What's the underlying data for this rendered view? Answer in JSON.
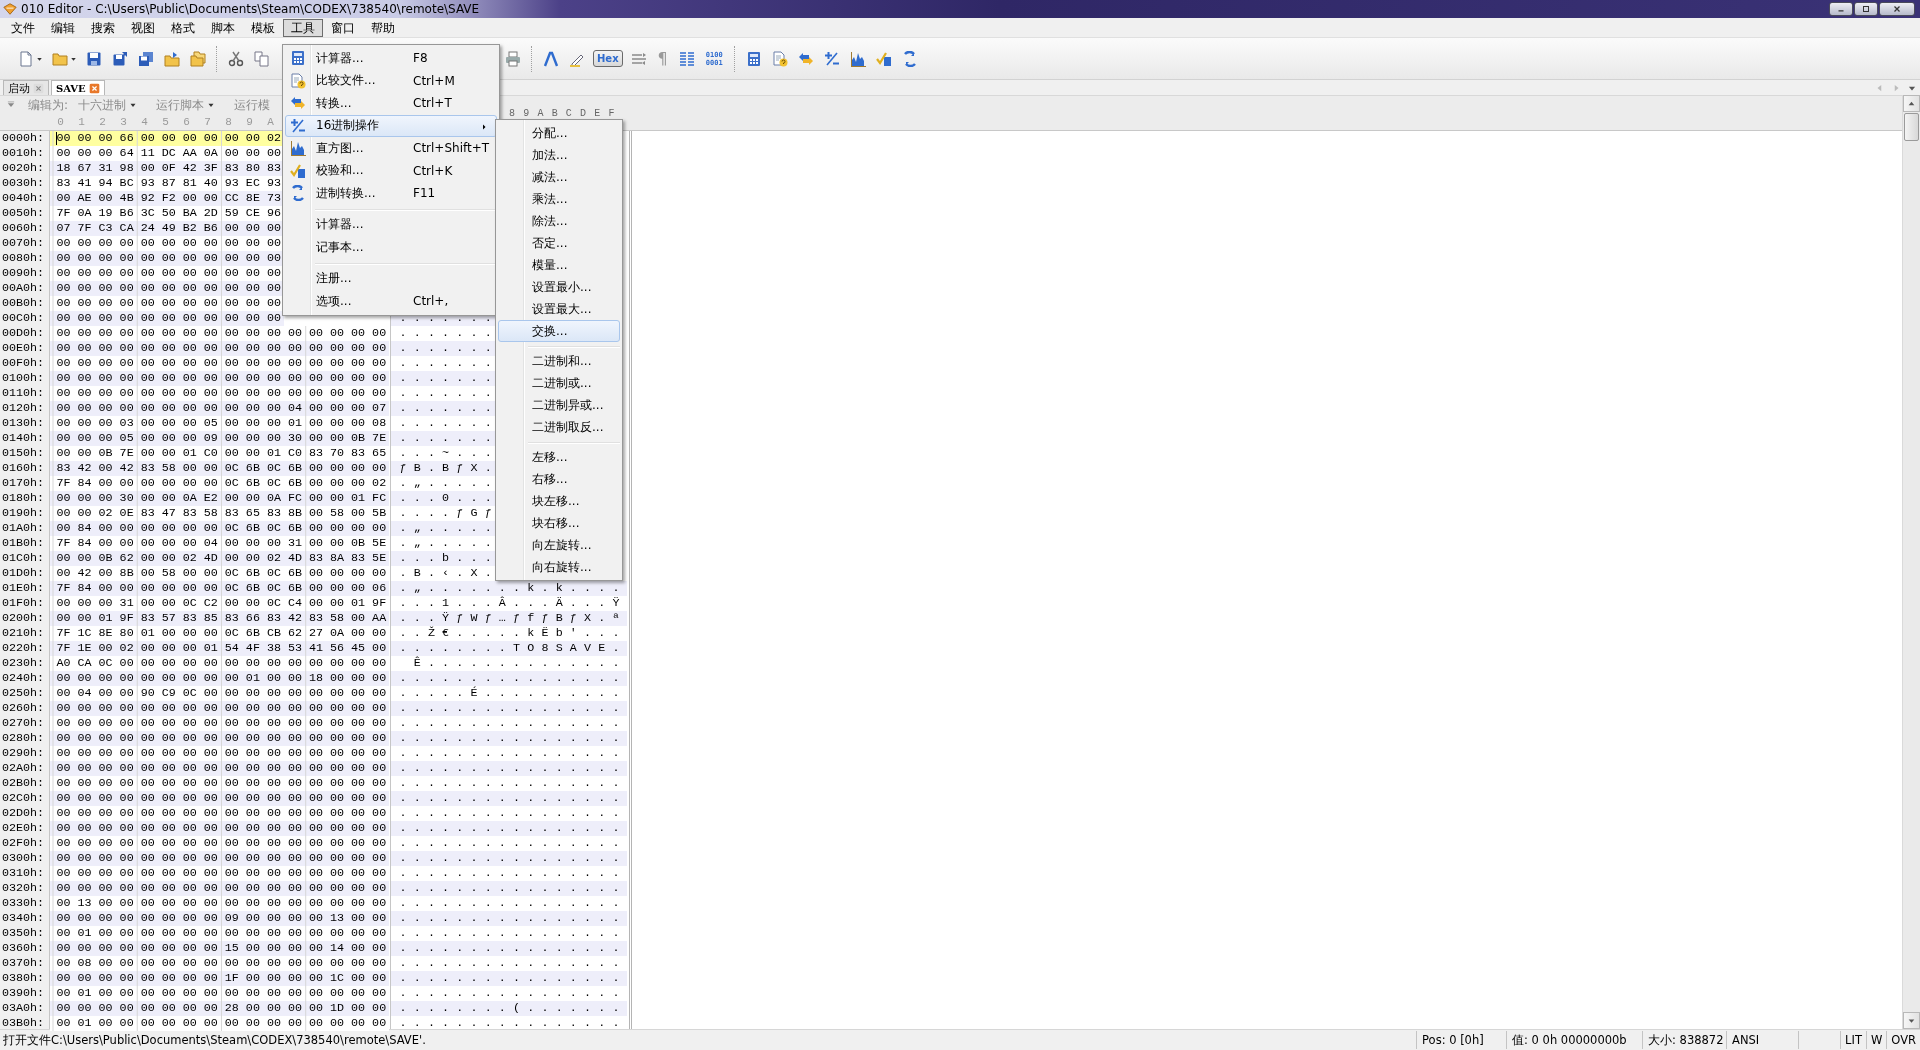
{
  "window": {
    "title": "010 Editor - C:\\Users\\Public\\Documents\\Steam\\CODEX\\738540\\remote\\SAVE"
  },
  "menubar": [
    {
      "label": "文件",
      "selected": false
    },
    {
      "label": "编辑",
      "selected": false
    },
    {
      "label": "搜索",
      "selected": false
    },
    {
      "label": "视图",
      "selected": false
    },
    {
      "label": "格式",
      "selected": false
    },
    {
      "label": "脚本",
      "selected": false
    },
    {
      "label": "模板",
      "selected": false
    },
    {
      "label": "工具",
      "selected": true
    },
    {
      "label": "窗口",
      "selected": false
    },
    {
      "label": "帮助",
      "selected": false
    }
  ],
  "toolbar": {
    "hex_button": {
      "label": "Hex",
      "on": true
    },
    "paragraph_mark": "¶",
    "bits_label": [
      "0100",
      "0001"
    ]
  },
  "tabs": [
    {
      "label": "启动",
      "selected": false
    },
    {
      "label": "SAVE",
      "selected": true
    }
  ],
  "editor_bar": {
    "edit_as_label": "编辑为:",
    "edit_as_value": "十六进制",
    "run_script": "运行脚本",
    "run_template": "运行模"
  },
  "columns": {
    "hex": [
      "0",
      "1",
      "2",
      "3",
      "4",
      "5",
      "6",
      "7",
      "8",
      "9",
      "A"
    ],
    "text": [
      "8",
      "9",
      "A",
      "B",
      "C",
      "D",
      "E",
      "F"
    ]
  },
  "rows": [
    {
      "offset": "0000h:",
      "hex": "00 00 00 66 00 00 00 00 00 00 02",
      "selected": true
    },
    {
      "offset": "0010h:",
      "hex": "00 00 00 64 11 DC AA 0A 00 00 00",
      "selected": false
    },
    {
      "offset": "0020h:",
      "hex": "18 67 31 98 00 0F 42 3F 83 80 83",
      "selected": false
    },
    {
      "offset": "0030h:",
      "hex": "83 41 94 BC 93 87 81 40 93 EC 93",
      "selected": false
    },
    {
      "offset": "0040h:",
      "hex": "00 AE 00 4B 92 F2 00 00 CC 8E 73",
      "selected": false
    },
    {
      "offset": "0050h:",
      "hex": "7F 0A 19 B6 3C 50 BA 2D 59 CE 96",
      "selected": false
    },
    {
      "offset": "0060h:",
      "hex": "07 7F C3 CA 24 49 B2 B6 00 00 00",
      "selected": false
    },
    {
      "offset": "0070h:",
      "hex": "00 00 00 00 00 00 00 00 00 00 00",
      "selected": false
    },
    {
      "offset": "0080h:",
      "hex": "00 00 00 00 00 00 00 00 00 00 00",
      "selected": false
    },
    {
      "offset": "0090h:",
      "hex": "00 00 00 00 00 00 00 00 00 00 00",
      "selected": false
    },
    {
      "offset": "00A0h:",
      "hex": "00 00 00 00 00 00 00 00 00 00 00",
      "selected": false
    },
    {
      "offset": "00B0h:",
      "hex": "00 00 00 00 00 00 00 00 00 00 00",
      "selected": false
    },
    {
      "offset": "00C0h:",
      "hex": "00 00 00 00 00 00 00 00 00 00 00",
      "text": ".......",
      "selected": false
    },
    {
      "offset": "00D0h:",
      "hex": "00 00 00 00 00 00 00 00 00 00 00 00 00 00 00 00",
      "text": ".......",
      "selected": false
    },
    {
      "offset": "00E0h:",
      "hex": "00 00 00 00 00 00 00 00 00 00 00 00 00 00 00 00",
      "text": ".......",
      "selected": false
    },
    {
      "offset": "00F0h:",
      "hex": "00 00 00 00 00 00 00 00 00 00 00 00 00 00 00 00",
      "text": ".......",
      "selected": false
    },
    {
      "offset": "0100h:",
      "hex": "00 00 00 00 00 00 00 00 00 00 00 00 00 00 00 00",
      "text": ".......",
      "selected": false
    },
    {
      "offset": "0110h:",
      "hex": "00 00 00 00 00 00 00 00 00 00 00 00 00 00 00 00",
      "text": ".......",
      "selected": false
    },
    {
      "offset": "0120h:",
      "hex": "00 00 00 00 00 00 00 00 00 00 00 04 00 00 00 07",
      "text": ".......",
      "selected": false
    },
    {
      "offset": "0130h:",
      "hex": "00 00 00 03 00 00 00 05 00 00 00 01 00 00 00 08",
      "text": ".......",
      "selected": false
    },
    {
      "offset": "0140h:",
      "hex": "00 00 00 05 00 00 00 09 00 00 00 30 00 00 0B 7E",
      "text": ".......",
      "selected": false
    },
    {
      "offset": "0150h:",
      "hex": "00 00 0B 7E 00 00 01 C0 00 00 01 C0 83 70 83 65",
      "text": "...~...",
      "selected": false
    },
    {
      "offset": "0160h:",
      "hex": "83 42 00 42 83 58 00 00 0C 6B 0C 6B 00 00 00 00",
      "text": "ƒB.BƒX.",
      "selected": false
    },
    {
      "offset": "0170h:",
      "hex": "7F 84 00 00 00 00 00 00 0C 6B 0C 6B 00 00 00 02",
      "text": ".„.....",
      "selected": false
    },
    {
      "offset": "0180h:",
      "hex": "00 00 00 30 00 00 0A E2 00 00 0A FC 00 00 01 FC",
      "text": "...0...",
      "selected": false
    },
    {
      "offset": "0190h:",
      "hex": "00 00 02 0E 83 47 83 58 83 65 83 8B 00 58 00 5B",
      "text": "....ƒGƒ",
      "selected": false
    },
    {
      "offset": "01A0h:",
      "hex": "00 84 00 00 00 00 00 00 0C 6B 0C 6B 00 00 00 00",
      "text": ".„.....",
      "selected": false
    },
    {
      "offset": "01B0h:",
      "hex": "7F 84 00 00 00 00 00 04 00 00 00 31 00 00 0B 5E",
      "text": ".„.....",
      "selected": false
    },
    {
      "offset": "01C0h:",
      "hex": "00 00 0B 62 00 00 02 4D 00 00 02 4D 83 8A 83 5E",
      "text": "...b...",
      "selected": false
    },
    {
      "offset": "01D0h:",
      "hex": "00 42 00 8B 00 58 00 00 0C 6B 0C 6B 00 00 00 00",
      "text": ".B.‹.X.",
      "selected": false
    },
    {
      "offset": "01E0h:",
      "hex": "7F 84 00 00 00 00 00 00 0C 6B 0C 6B 00 00 00 06",
      "text": ".„.......k.k....",
      "selected": false
    },
    {
      "offset": "01F0h:",
      "hex": "00 00 00 31 00 00 0C C2 00 00 0C C4 00 00 01 9F",
      "text": "...1...Â...Ä...Ÿ",
      "selected": false
    },
    {
      "offset": "0200h:",
      "hex": "00 00 01 9F 83 57 83 85 83 66 83 42 83 58 00 AA",
      "text": "...ŸƒWƒ…ƒfƒBƒX.ª",
      "selected": false
    },
    {
      "offset": "0210h:",
      "hex": "7F 1C 8E 80 01 00 00 00 0C 6B CB 62 27 0A 00 00",
      "text": "..Ž€.....kËb'...",
      "selected": false
    },
    {
      "offset": "0220h:",
      "hex": "7F 1E 00 02 00 00 00 01 54 4F 38 53 41 56 45 00",
      "text": "........TO8SAVE.",
      "selected": false
    },
    {
      "offset": "0230h:",
      "hex": "A0 CA 0C 00 00 00 00 00 00 00 00 00 00 00 00 00",
      "text": " Ê..............",
      "selected": false
    },
    {
      "offset": "0240h:",
      "hex": "00 00 00 00 00 00 00 00 00 01 00 00 18 00 00 00",
      "text": "................",
      "selected": false
    },
    {
      "offset": "0250h:",
      "hex": "00 04 00 00 90 C9 0C 00 00 00 00 00 00 00 00 00",
      "text": ".....É..........",
      "selected": false
    },
    {
      "offset": "0260h:",
      "hex": "00 00 00 00 00 00 00 00 00 00 00 00 00 00 00 00",
      "text": "................",
      "selected": false
    },
    {
      "offset": "0270h:",
      "hex": "00 00 00 00 00 00 00 00 00 00 00 00 00 00 00 00",
      "text": "................",
      "selected": false
    },
    {
      "offset": "0280h:",
      "hex": "00 00 00 00 00 00 00 00 00 00 00 00 00 00 00 00",
      "text": "................",
      "selected": false
    },
    {
      "offset": "0290h:",
      "hex": "00 00 00 00 00 00 00 00 00 00 00 00 00 00 00 00",
      "text": "................",
      "selected": false
    },
    {
      "offset": "02A0h:",
      "hex": "00 00 00 00 00 00 00 00 00 00 00 00 00 00 00 00",
      "text": "................",
      "selected": false
    },
    {
      "offset": "02B0h:",
      "hex": "00 00 00 00 00 00 00 00 00 00 00 00 00 00 00 00",
      "text": "................",
      "selected": false
    },
    {
      "offset": "02C0h:",
      "hex": "00 00 00 00 00 00 00 00 00 00 00 00 00 00 00 00",
      "text": "................",
      "selected": false
    },
    {
      "offset": "02D0h:",
      "hex": "00 00 00 00 00 00 00 00 00 00 00 00 00 00 00 00",
      "text": "................",
      "selected": false
    },
    {
      "offset": "02E0h:",
      "hex": "00 00 00 00 00 00 00 00 00 00 00 00 00 00 00 00",
      "text": "................",
      "selected": false
    },
    {
      "offset": "02F0h:",
      "hex": "00 00 00 00 00 00 00 00 00 00 00 00 00 00 00 00",
      "text": "................",
      "selected": false
    },
    {
      "offset": "0300h:",
      "hex": "00 00 00 00 00 00 00 00 00 00 00 00 00 00 00 00",
      "text": "................",
      "selected": false
    },
    {
      "offset": "0310h:",
      "hex": "00 00 00 00 00 00 00 00 00 00 00 00 00 00 00 00",
      "text": "................",
      "selected": false
    },
    {
      "offset": "0320h:",
      "hex": "00 00 00 00 00 00 00 00 00 00 00 00 00 00 00 00",
      "text": "................",
      "selected": false
    },
    {
      "offset": "0330h:",
      "hex": "00 13 00 00 00 00 00 00 00 00 00 00 00 00 00 00",
      "text": "................",
      "selected": false
    },
    {
      "offset": "0340h:",
      "hex": "00 00 00 00 00 00 00 00 09 00 00 00 00 13 00 00",
      "text": "................",
      "selected": false
    },
    {
      "offset": "0350h:",
      "hex": "00 01 00 00 00 00 00 00 00 00 00 00 00 00 00 00",
      "text": "................",
      "selected": false
    },
    {
      "offset": "0360h:",
      "hex": "00 00 00 00 00 00 00 00 15 00 00 00 00 14 00 00",
      "text": "................",
      "selected": false
    },
    {
      "offset": "0370h:",
      "hex": "00 08 00 00 00 00 00 00 00 00 00 00 00 00 00 00",
      "text": "................",
      "selected": false
    },
    {
      "offset": "0380h:",
      "hex": "00 00 00 00 00 00 00 00 1F 00 00 00 00 1C 00 00",
      "text": "................",
      "selected": false
    },
    {
      "offset": "0390h:",
      "hex": "00 01 00 00 00 00 00 00 00 00 00 00 00 00 00 00",
      "text": "................",
      "selected": false
    },
    {
      "offset": "03A0h:",
      "hex": "00 00 00 00 00 00 00 00 28 00 00 00 00 1D 00 00",
      "text": "........(.......",
      "selected": false
    },
    {
      "offset": "03B0h:",
      "hex": "00 01 00 00 00 00 00 00 00 00 00 00 00 00 00 00",
      "text": "................",
      "selected": false
    }
  ],
  "tools_menu": [
    {
      "kind": "item",
      "label": "计算器...",
      "shortcut": "F8",
      "submenu": false,
      "selected": false
    },
    {
      "kind": "item",
      "label": "比较文件...",
      "shortcut": "Ctrl+M",
      "submenu": false,
      "selected": false
    },
    {
      "kind": "item",
      "label": "转换...",
      "shortcut": "Ctrl+T",
      "submenu": false,
      "selected": false
    },
    {
      "kind": "item",
      "label": "16进制操作",
      "submenu": true,
      "selected": true
    },
    {
      "kind": "item",
      "label": "直方图...",
      "shortcut": "Ctrl+Shift+T",
      "submenu": false,
      "selected": false
    },
    {
      "kind": "item",
      "label": "校验和...",
      "shortcut": "Ctrl+K",
      "submenu": false,
      "selected": false
    },
    {
      "kind": "item",
      "label": "进制转换...",
      "shortcut": "F11",
      "submenu": false,
      "selected": false
    },
    {
      "kind": "separator"
    },
    {
      "kind": "item",
      "label": "计算器...",
      "submenu": false,
      "selected": false
    },
    {
      "kind": "item",
      "label": "记事本...",
      "submenu": false,
      "selected": false
    },
    {
      "kind": "separator"
    },
    {
      "kind": "item",
      "label": "注册...",
      "submenu": false,
      "selected": false
    },
    {
      "kind": "item",
      "label": "选项...",
      "shortcut": "Ctrl+,",
      "submenu": false,
      "selected": false
    }
  ],
  "hex_ops_menu": [
    {
      "kind": "item",
      "label": "分配...",
      "selected": false
    },
    {
      "kind": "item",
      "label": "加法...",
      "selected": false
    },
    {
      "kind": "item",
      "label": "减法...",
      "selected": false
    },
    {
      "kind": "item",
      "label": "乘法...",
      "selected": false
    },
    {
      "kind": "item",
      "label": "除法...",
      "selected": false
    },
    {
      "kind": "item",
      "label": "否定...",
      "selected": false
    },
    {
      "kind": "item",
      "label": "模量...",
      "selected": false
    },
    {
      "kind": "item",
      "label": "设置最小...",
      "selected": false
    },
    {
      "kind": "item",
      "label": "设置最大...",
      "selected": false
    },
    {
      "kind": "item",
      "label": "交换...",
      "selected": true
    },
    {
      "kind": "separator"
    },
    {
      "kind": "item",
      "label": "二进制和...",
      "selected": false
    },
    {
      "kind": "item",
      "label": "二进制或...",
      "selected": false
    },
    {
      "kind": "item",
      "label": "二进制异或...",
      "selected": false
    },
    {
      "kind": "item",
      "label": "二进制取反...",
      "selected": false
    },
    {
      "kind": "separator"
    },
    {
      "kind": "item",
      "label": "左移...",
      "selected": false
    },
    {
      "kind": "item",
      "label": "右移...",
      "selected": false
    },
    {
      "kind": "item",
      "label": "块左移...",
      "selected": false
    },
    {
      "kind": "item",
      "label": "块右移...",
      "selected": false
    },
    {
      "kind": "item",
      "label": "向左旋转...",
      "selected": false
    },
    {
      "kind": "item",
      "label": "向右旋转...",
      "selected": false
    }
  ],
  "status_bar": {
    "message": "打开文件C:\\Users\\Public\\Documents\\Steam\\CODEX\\738540\\remote\\SAVE'.",
    "position": "Pos: 0 [0h]",
    "value": "值: 0 0h 00000000b",
    "size": "大小: 838872",
    "encoding": "ANSI",
    "flags": [
      "LIT",
      "W",
      "OVR"
    ]
  }
}
